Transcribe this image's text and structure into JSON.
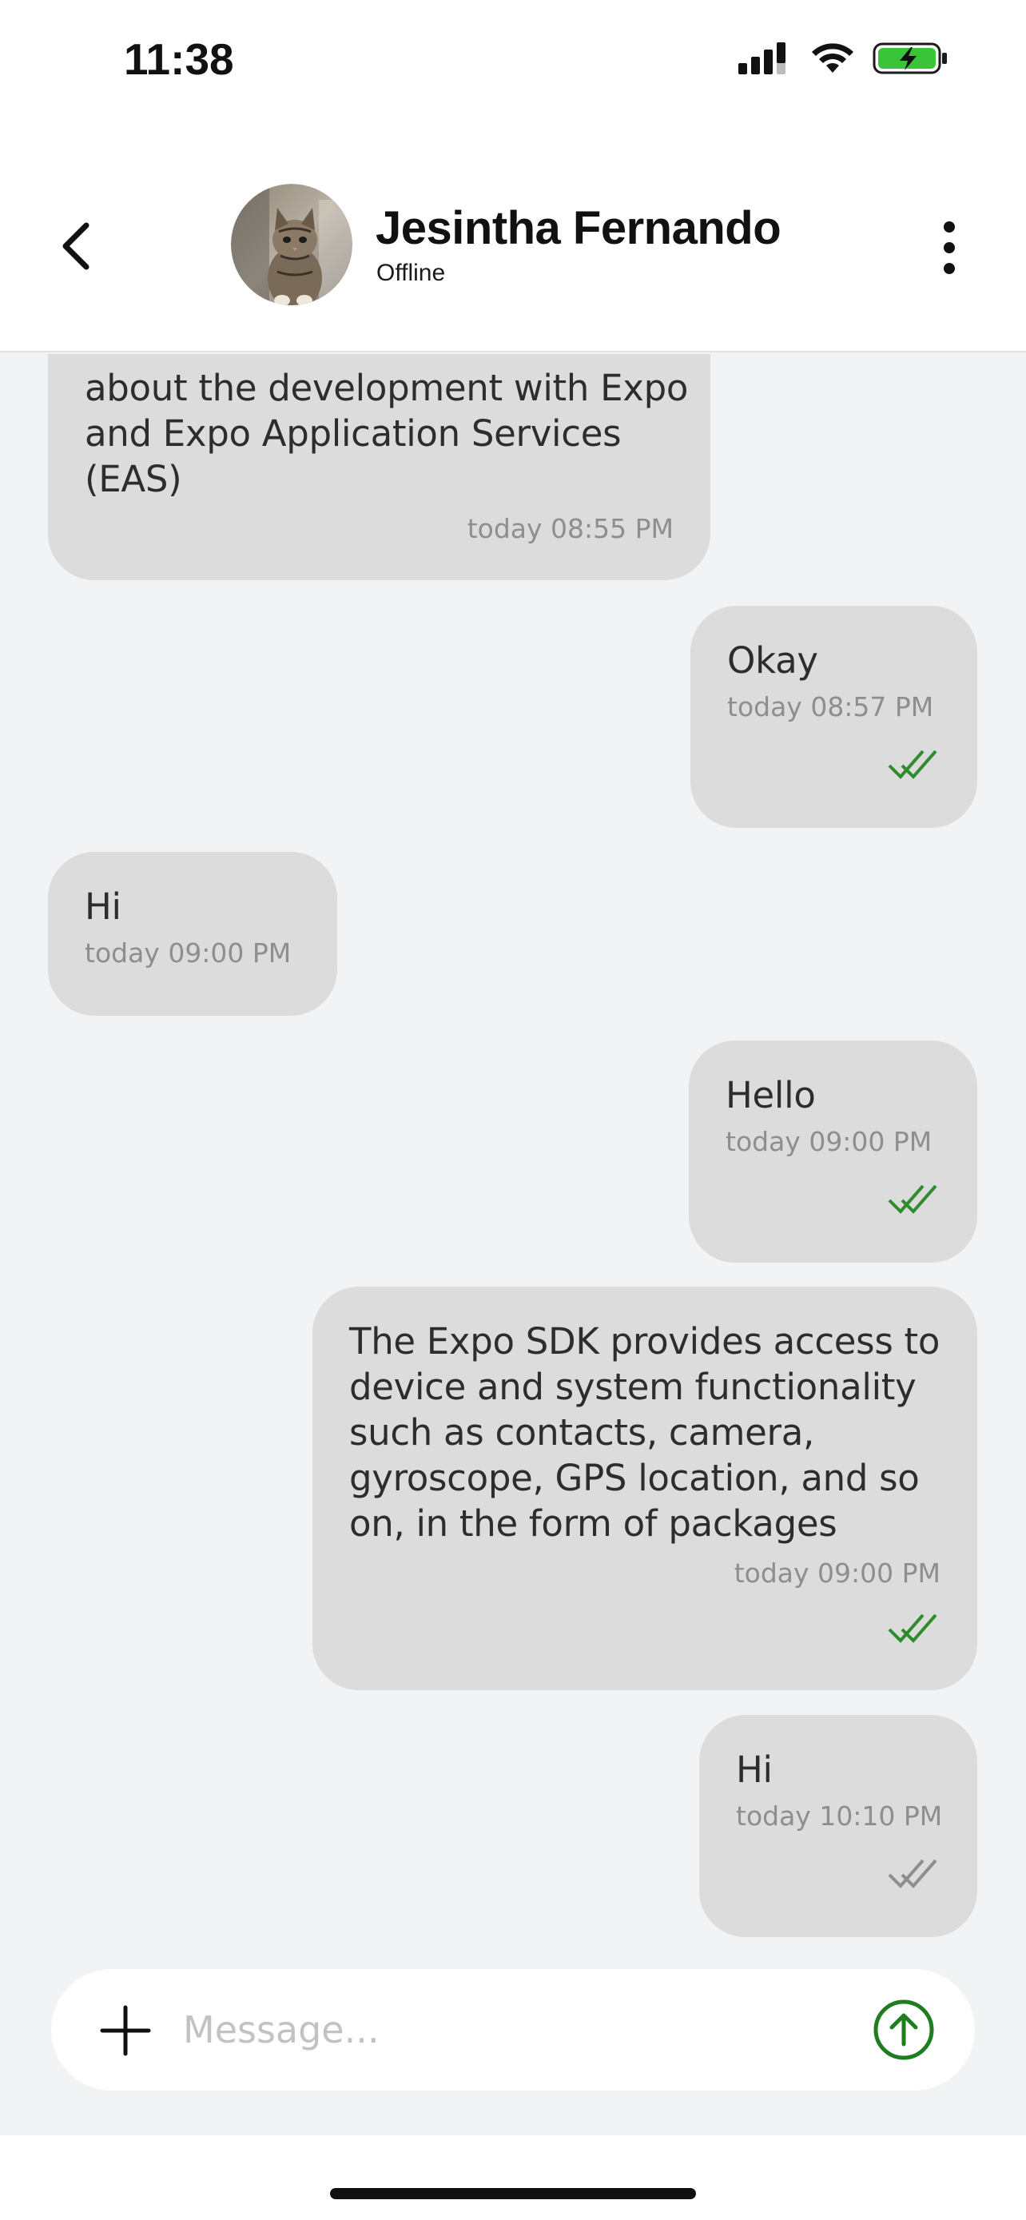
{
  "status_bar": {
    "time": "11:38"
  },
  "header": {
    "contact_name": "Jesintha Fernando",
    "contact_status": "Offline"
  },
  "messages": [
    {
      "direction": "incoming",
      "text": "about the development with Expo and Expo Application Services (EAS)",
      "time": "today 08:55 PM"
    },
    {
      "direction": "outgoing",
      "text": "Okay",
      "time": "today 08:57 PM",
      "status": "read"
    },
    {
      "direction": "incoming",
      "text": "Hi",
      "time": "today 09:00 PM"
    },
    {
      "direction": "outgoing",
      "text": "Hello",
      "time": "today 09:00 PM",
      "status": "read"
    },
    {
      "direction": "outgoing",
      "text": "The Expo SDK provides access to device and system functionality such as contacts, camera, gyroscope, GPS location, and so on, in the form of packages",
      "time": "today 09:00 PM",
      "status": "read"
    },
    {
      "direction": "outgoing",
      "text": "Hi",
      "time": "today 10:10 PM",
      "status": "delivered"
    }
  ],
  "composer": {
    "placeholder": "Message..."
  },
  "colors": {
    "read_tick": "#2e8b2e",
    "delivered_tick": "#8e8e8e",
    "send_accent": "#1e7d1e",
    "bubble": "#dcdcdc",
    "background": "#f2f3f5"
  },
  "icons": {
    "back": "chevron-left-icon",
    "more": "vertical-dots-icon",
    "attach": "plus-icon",
    "send": "arrow-up-circle-icon"
  }
}
